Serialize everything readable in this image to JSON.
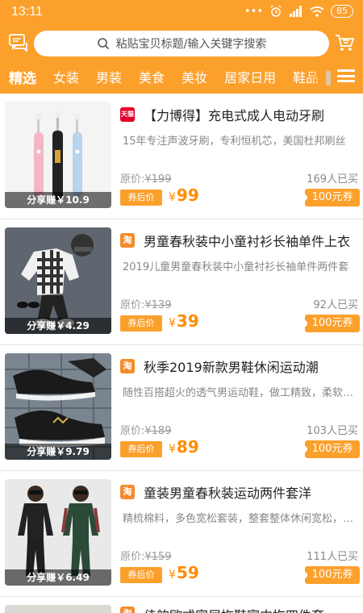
{
  "status": {
    "time": "13:11",
    "battery": "85"
  },
  "search": {
    "placeholder": "粘贴宝贝标题/输入关键字搜索"
  },
  "tabs": [
    "精选",
    "女装",
    "男装",
    "美食",
    "美妆",
    "居家日用",
    "鞋品"
  ],
  "products": [
    {
      "platform": "天猫",
      "title": "【力博得】充电式成人电动牙刷",
      "desc": "15年专注声波牙刷，专利恒机芯，美国杜邦刷丝",
      "orig_label": "原价:",
      "orig_price": "¥199",
      "sold": "169人已买",
      "coupon_tag": "券后价",
      "price": "99",
      "coupon": "100元券",
      "share": "分享赚￥10.9"
    },
    {
      "platform": "淘",
      "title": "男童春秋装中小童衬衫长袖单件上衣",
      "desc": "2019儿童男童春秋装中小童衬衫长袖单件两件套",
      "orig_label": "原价:",
      "orig_price": "¥139",
      "sold": "92人已买",
      "coupon_tag": "券后价",
      "price": "39",
      "coupon": "100元券",
      "share": "分享赚￥4.29"
    },
    {
      "platform": "淘",
      "title": "秋季2019新款男鞋休闲运动潮",
      "desc": "随性百搭超火的透气男运动鞋，做工精致，柔软舒适",
      "orig_label": "原价:",
      "orig_price": "¥189",
      "sold": "103人已买",
      "coupon_tag": "券后价",
      "price": "89",
      "coupon": "100元券",
      "share": "分享赚￥9.79"
    },
    {
      "platform": "淘",
      "title": "童装男童春秋装运动两件套洋",
      "desc": "精梳棉料，多色宽松套装，整套整体休闲宽松，舒适",
      "orig_label": "原价:",
      "orig_price": "¥159",
      "sold": "111人已买",
      "coupon_tag": "券后价",
      "price": "59",
      "coupon": "100元券",
      "share": "分享赚￥6.49"
    }
  ],
  "partial": {
    "platform": "淘",
    "title": "佳韵欧式家居拖鞋室内拖四件套"
  },
  "colors": {
    "accent": "#fca02c",
    "price": "#ff8c00"
  }
}
